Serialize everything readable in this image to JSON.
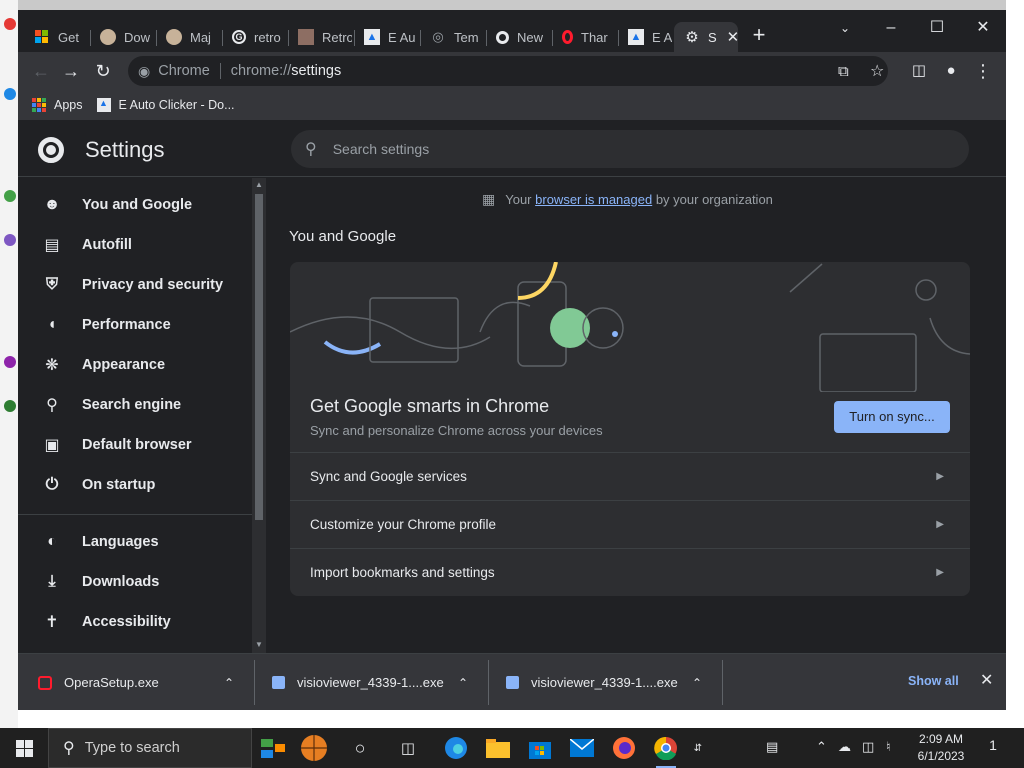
{
  "tabs": [
    {
      "label": "Get",
      "icon": "microsoft-icon"
    },
    {
      "label": "Dow",
      "icon": "cat-icon"
    },
    {
      "label": "Maj",
      "icon": "cat-icon"
    },
    {
      "label": "retro",
      "icon": "google-icon"
    },
    {
      "label": "Retro",
      "icon": "avatar-icon"
    },
    {
      "label": "E Au",
      "icon": "autoclicker-icon"
    },
    {
      "label": "Tem",
      "icon": "globe-icon"
    },
    {
      "label": "New",
      "icon": "chrome-icon"
    },
    {
      "label": "Thar",
      "icon": "opera-icon"
    },
    {
      "label": "E Au",
      "icon": "autoclicker-icon"
    },
    {
      "label": "S",
      "icon": "gear-icon",
      "active": true
    }
  ],
  "toolbar": {
    "omnibox_label": "Chrome",
    "url_scheme": "chrome://",
    "url_host": "settings"
  },
  "bookmarks": {
    "apps": "Apps",
    "item1": "E Auto Clicker - Do..."
  },
  "settings": {
    "title": "Settings",
    "search_placeholder": "Search settings",
    "managed_prefix": "Your",
    "managed_link": "browser is managed",
    "managed_suffix": "by your organization",
    "section_title": "You and Google",
    "promo_title": "Get Google smarts in Chrome",
    "promo_subtitle": "Sync and personalize Chrome across your devices",
    "sync_button": "Turn on sync...",
    "rows": [
      "Sync and Google services",
      "Customize your Chrome profile",
      "Import bookmarks and settings"
    ],
    "nav": [
      {
        "label": "You and Google",
        "icon": "person-icon"
      },
      {
        "label": "Autofill",
        "icon": "clipboard-icon"
      },
      {
        "label": "Privacy and security",
        "icon": "shield-icon"
      },
      {
        "label": "Performance",
        "icon": "speedometer-icon"
      },
      {
        "label": "Appearance",
        "icon": "palette-icon"
      },
      {
        "label": "Search engine",
        "icon": "search-icon"
      },
      {
        "label": "Default browser",
        "icon": "browser-icon"
      },
      {
        "label": "On startup",
        "icon": "power-icon"
      },
      {
        "label": "Languages",
        "icon": "globe-icon"
      },
      {
        "label": "Downloads",
        "icon": "download-icon"
      },
      {
        "label": "Accessibility",
        "icon": "accessibility-icon"
      }
    ]
  },
  "downloads": {
    "items": [
      "OperaSetup.exe",
      "visioviewer_4339-1....exe",
      "visioviewer_4339-1....exe"
    ],
    "show_all": "Show all"
  },
  "taskbar": {
    "search_placeholder": "Type to search",
    "time": "2:09 AM",
    "date": "6/1/2023",
    "notification_count": "1"
  },
  "colors": {
    "accent": "#8ab4f8",
    "background": "#202124",
    "surface": "#2d2e31"
  }
}
